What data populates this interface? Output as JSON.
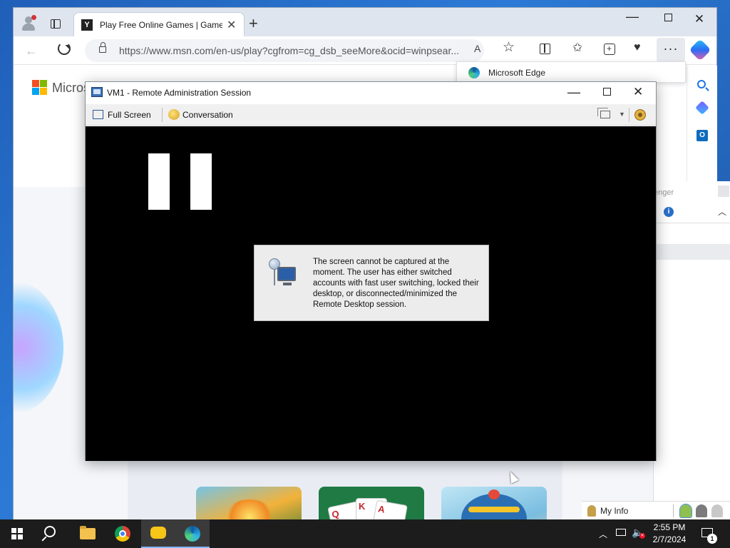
{
  "browser": {
    "tab_title": "Play Free Online Games | Games",
    "tab_favicon": "Y",
    "url": "https://www.msn.com/en-us/play?cgfrom=cg_dsb_seeMore&ocid=winpsear...",
    "readaloud_label": "A",
    "more_label": "···",
    "icons": [
      "profile-icon",
      "tab-actions-icon",
      "close-icon",
      "new-tab-icon",
      "back-icon",
      "refresh-icon",
      "lock-icon",
      "favorite-icon",
      "split-screen-icon",
      "favorites-icon",
      "collections-icon",
      "performance-icon",
      "more-icon",
      "copilot-icon"
    ]
  },
  "page": {
    "brand_text": "Micros"
  },
  "edge_panel": {
    "text": "Microsoft Edge"
  },
  "messenger": {
    "title_fragment": "enger",
    "my_info_label": "My Info"
  },
  "rdp": {
    "title": "VM1 - Remote Administration Session",
    "toolbar": {
      "full_screen_label": "Full Screen",
      "conversation_label": "Conversation"
    },
    "message": "The screen cannot be captured at the moment. The user has either switched accounts with fast user switching, locked their desktop, or disconnected/minimized the Remote Desktop session."
  },
  "games": [
    {
      "name": "game-card-1",
      "cards": []
    },
    {
      "name": "game-card-2",
      "cards": [
        "Q",
        "K",
        "A"
      ]
    },
    {
      "name": "game-card-3",
      "cards": []
    }
  ],
  "taskbar": {
    "time": "2:55 PM",
    "date": "2/7/2024",
    "notification_count": "1",
    "apps": [
      "start-icon",
      "search-icon",
      "file-explorer-icon",
      "chrome-icon",
      "chat-icon",
      "edge-icon"
    ]
  },
  "colors": {
    "accent": "#1a73e8",
    "rdp_screen": "#000000",
    "taskbar": "#1c1c1c"
  }
}
